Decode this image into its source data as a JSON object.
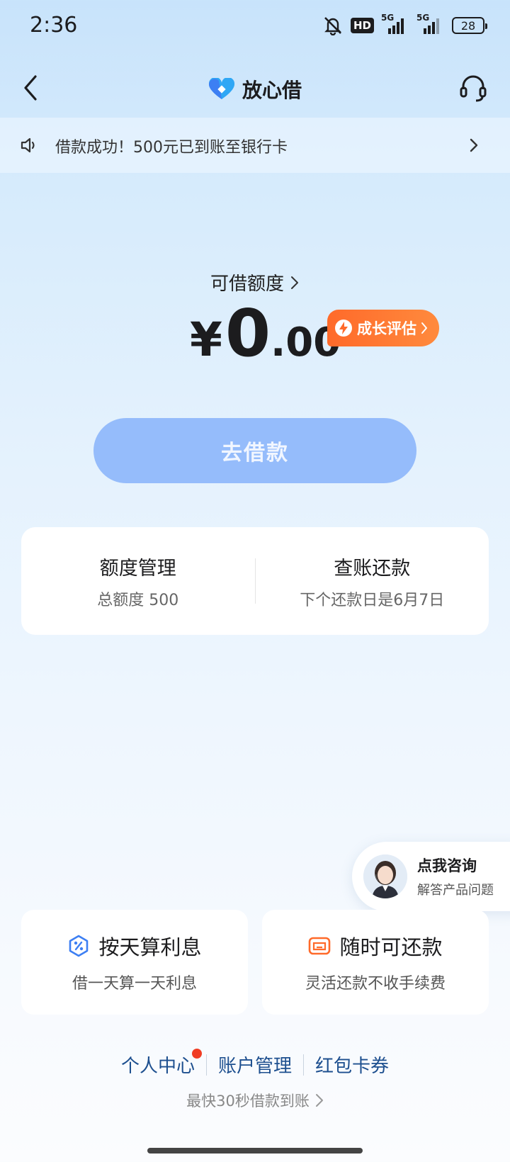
{
  "status_bar": {
    "time": "2:36",
    "hd_label": "HD",
    "signal1_label": "5G",
    "signal2_label": "5G",
    "battery": "28"
  },
  "header": {
    "title": "放心借",
    "back_icon": "chevron-left-icon",
    "service_icon": "headset-icon"
  },
  "notice": {
    "text": "借款成功！500元已到账至银行卡"
  },
  "credit": {
    "label": "可借额度",
    "currency": "¥",
    "integer": "0",
    "decimal": ".00",
    "growth_label": "成长评估"
  },
  "borrow_button": {
    "label": "去借款"
  },
  "info_card": {
    "left": {
      "title": "额度管理",
      "sub": "总额度 500"
    },
    "right": {
      "title": "查账还款",
      "sub": "下个还款日是6月7日"
    }
  },
  "consult": {
    "title": "点我咨询",
    "sub": "解答产品问题"
  },
  "features": [
    {
      "title": "按天算利息",
      "sub": "借一天算一天利息",
      "icon": "percent-icon"
    },
    {
      "title": "随时可还款",
      "sub": "灵活还款不收手续费",
      "icon": "wallet-icon"
    }
  ],
  "footer": {
    "links": [
      "个人中心",
      "账户管理",
      "红包卡券"
    ],
    "note": "最快30秒借款到账"
  },
  "colors": {
    "accent_orange": "#ff6a2a",
    "button_blue": "#95bcfb",
    "link_blue": "#1d4f8f"
  }
}
